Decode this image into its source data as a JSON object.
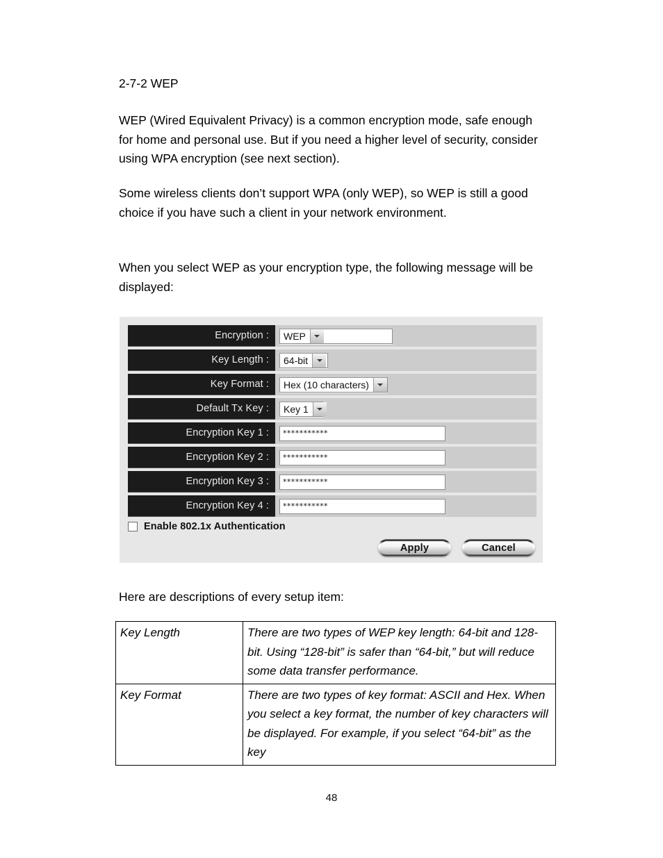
{
  "document": {
    "heading": "2-7-2 WEP",
    "paragraphs": [
      "WEP (Wired Equivalent Privacy) is a common encryption mode, safe enough for home and personal use. But if you need a higher level of security, consider using WPA encryption (see next section).",
      "Some wireless clients don’t support WPA (only WEP), so WEP is still a good choice if you have such a client in your network environment.",
      "When you select WEP as your encryption type, the following message will be displayed:",
      "Here are descriptions of every setup item:"
    ],
    "page_number": "48"
  },
  "panel": {
    "rows": [
      {
        "label": "Encryption :",
        "control": "select",
        "value": "WEP"
      },
      {
        "label": "Key Length :",
        "control": "select",
        "value": "64-bit"
      },
      {
        "label": "Key Format :",
        "control": "select",
        "value": "Hex (10 characters)"
      },
      {
        "label": "Default Tx Key :",
        "control": "select",
        "value": "Key 1"
      },
      {
        "label": "Encryption Key 1 :",
        "control": "password",
        "value": "***********"
      },
      {
        "label": "Encryption Key 2 :",
        "control": "password",
        "value": "***********"
      },
      {
        "label": "Encryption Key 3 :",
        "control": "password",
        "value": "***********"
      },
      {
        "label": "Encryption Key 4 :",
        "control": "password",
        "value": "***********"
      }
    ],
    "checkbox": {
      "label": "Enable 802.1x Authentication",
      "checked": false
    },
    "buttons": {
      "apply": "Apply",
      "cancel": "Cancel"
    },
    "colors": {
      "panel_background": "#e7e7e7",
      "row_stripe": "#cccccc",
      "label_block": "#1b1b1b",
      "label_text": "#e9e9e9"
    }
  },
  "description_table": {
    "rows": [
      {
        "term": "Key Length",
        "definition": "There are two types of WEP key length: 64-bit and 128-bit. Using “128-bit” is safer than “64-bit,” but will reduce some data transfer performance."
      },
      {
        "term": "Key Format",
        "definition": "There are two types of key format: ASCII and Hex. When you select a key format, the number of key characters will be displayed. For example, if you select “64-bit” as the key"
      }
    ]
  }
}
